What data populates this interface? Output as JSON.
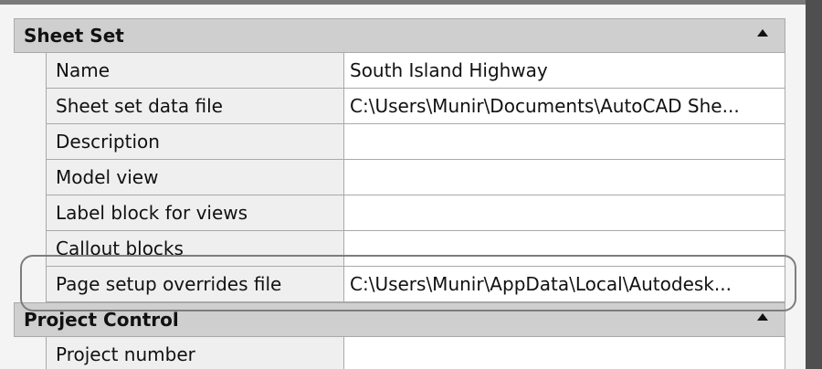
{
  "sections": [
    {
      "title": "Sheet Set",
      "rows": [
        {
          "label": "Name",
          "value": "South Island Highway"
        },
        {
          "label": "Sheet set data file",
          "value": "C:\\Users\\Munir\\Documents\\AutoCAD She..."
        },
        {
          "label": "Description",
          "value": ""
        },
        {
          "label": "Model view",
          "value": ""
        },
        {
          "label": "Label block for views",
          "value": ""
        },
        {
          "label": "Callout blocks",
          "value": ""
        },
        {
          "label": "Page setup overrides file",
          "value": "C:\\Users\\Munir\\AppData\\Local\\Autodesk..."
        }
      ]
    },
    {
      "title": "Project Control",
      "rows": [
        {
          "label": "Project number",
          "value": ""
        }
      ]
    }
  ]
}
